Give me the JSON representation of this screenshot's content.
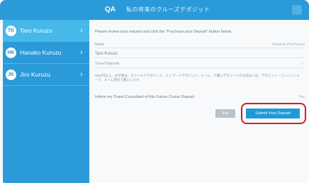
{
  "header": {
    "logo": "QA",
    "title": "私の将来のクルーズデポジット"
  },
  "sidebar": {
    "items": [
      {
        "initials": "TK",
        "name": "Taro Kuruzu",
        "active": true
      },
      {
        "initials": "HK",
        "name": "Hanako Kuruzu",
        "active": false
      },
      {
        "initials": "JK",
        "name": "Jiro Kuruzu",
        "active": false
      }
    ]
  },
  "main": {
    "instruction": "Please review your request and click the \"Purchase your Deposit\" button below.",
    "name_row": {
      "label": "Name",
      "right": "Deposits Per Person"
    },
    "name_value": "Taro Kuruzu",
    "deposit_row": {
      "label": "Travel Deposits"
    },
    "notes": "9000円以上、お子様は、チャイルドデポジット、ミニマードデポジット、ルーム、で購入デポジットのお支払いは、デポジット・フィニッシャーで、ルーム単位で購入します。",
    "inform": {
      "label": "Inform my Travel Consultant of this Future Cruise Deposit",
      "value": "Yes"
    },
    "buttons": {
      "exit": "Exit",
      "submit": "Submit Your Deposit"
    }
  },
  "colors": {
    "accent": "#2a9ad8",
    "highlight": "#d81b22"
  }
}
